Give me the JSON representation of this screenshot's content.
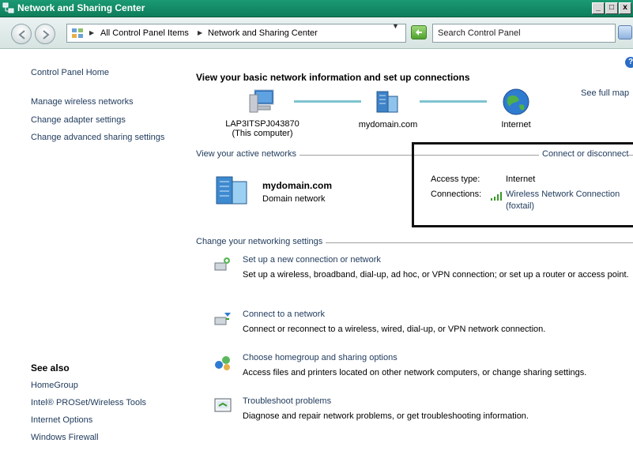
{
  "window": {
    "title": "Network and Sharing Center",
    "buttons": [
      "_",
      "□",
      "x"
    ]
  },
  "address": {
    "crumbs": [
      "All Control Panel Items",
      "Network and Sharing Center"
    ],
    "search_placeholder": "Search Control Panel"
  },
  "left_pane": {
    "home": "Control Panel Home",
    "links": [
      "Manage wireless networks",
      "Change adapter settings",
      "Change advanced sharing settings"
    ],
    "see_also_heading": "See also",
    "see_also": [
      "HomeGroup",
      "Intel® PROSet/Wireless Tools",
      "Internet Options",
      "Windows Firewall"
    ]
  },
  "main": {
    "title": "View your basic network information and set up connections",
    "see_full_map": "See full map",
    "map": {
      "computer_name": "LAP3ITSPJ043870",
      "computer_sub": "(This computer)",
      "domain": "mydomain.com",
      "internet": "Internet"
    },
    "active_networks_label": "View your active networks",
    "connect_link": "Connect or disconnect",
    "network": {
      "name": "mydomain.com",
      "type": "Domain network",
      "access_type_label": "Access type:",
      "access_type_value": "Internet",
      "connections_label": "Connections:",
      "connection_line1": "Wireless Network Connection",
      "connection_line2": "(foxtail)"
    },
    "change_settings_label": "Change your networking settings",
    "tasks": [
      {
        "link": "Set up a new connection or network",
        "desc": "Set up a wireless, broadband, dial-up, ad hoc, or VPN connection; or set up a router or access point."
      },
      {
        "link": "Connect to a network",
        "desc": "Connect or reconnect to a wireless, wired, dial-up, or VPN network connection."
      },
      {
        "link": "Choose homegroup and sharing options",
        "desc": "Access files and printers located on other network computers, or change sharing settings."
      },
      {
        "link": "Troubleshoot problems",
        "desc": "Diagnose and repair network problems, or get troubleshooting information."
      }
    ]
  },
  "colors": {
    "titlebar": "#0e7d5a",
    "link": "#1e395b",
    "map_line": "#7ec4cf"
  }
}
